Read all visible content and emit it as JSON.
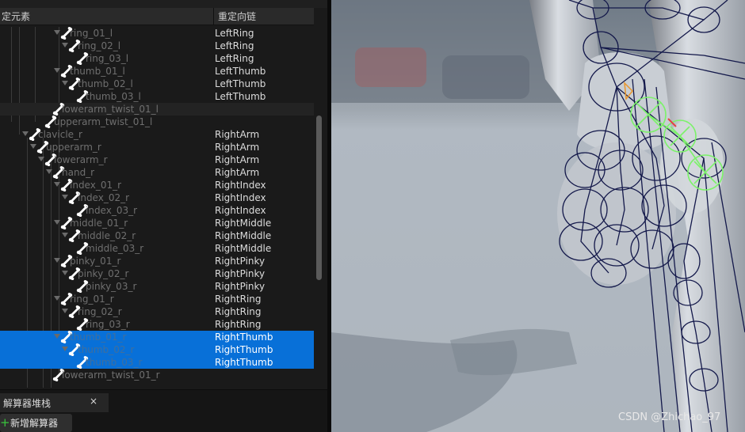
{
  "columns": {
    "element": "定元素",
    "chain": "重定向链"
  },
  "rows": [
    {
      "name": "ring_01_l",
      "chain": "LeftRing",
      "depth": 5,
      "expander": true,
      "state": ""
    },
    {
      "name": "ring_02_l",
      "chain": "LeftRing",
      "depth": 6,
      "expander": true,
      "state": ""
    },
    {
      "name": "ring_03_l",
      "chain": "LeftRing",
      "depth": 7,
      "expander": false,
      "state": ""
    },
    {
      "name": "thumb_01_l",
      "chain": "LeftThumb",
      "depth": 5,
      "expander": true,
      "state": ""
    },
    {
      "name": "thumb_02_l",
      "chain": "LeftThumb",
      "depth": 6,
      "expander": true,
      "state": ""
    },
    {
      "name": "thumb_03_l",
      "chain": "LeftThumb",
      "depth": 7,
      "expander": false,
      "state": ""
    },
    {
      "name": "lowerarm_twist_01_l",
      "chain": "",
      "depth": 4,
      "expander": false,
      "state": "hover"
    },
    {
      "name": "upperarm_twist_01_l",
      "chain": "",
      "depth": 3,
      "expander": false,
      "state": ""
    },
    {
      "name": "clavicle_r",
      "chain": "RightArm",
      "depth": 1,
      "expander": true,
      "state": ""
    },
    {
      "name": "upperarm_r",
      "chain": "RightArm",
      "depth": 2,
      "expander": true,
      "state": ""
    },
    {
      "name": "lowerarm_r",
      "chain": "RightArm",
      "depth": 3,
      "expander": true,
      "state": ""
    },
    {
      "name": "hand_r",
      "chain": "RightArm",
      "depth": 4,
      "expander": true,
      "state": ""
    },
    {
      "name": "index_01_r",
      "chain": "RightIndex",
      "depth": 5,
      "expander": true,
      "state": ""
    },
    {
      "name": "index_02_r",
      "chain": "RightIndex",
      "depth": 6,
      "expander": true,
      "state": ""
    },
    {
      "name": "index_03_r",
      "chain": "RightIndex",
      "depth": 7,
      "expander": false,
      "state": ""
    },
    {
      "name": "middle_01_r",
      "chain": "RightMiddle",
      "depth": 5,
      "expander": true,
      "state": ""
    },
    {
      "name": "middle_02_r",
      "chain": "RightMiddle",
      "depth": 6,
      "expander": true,
      "state": ""
    },
    {
      "name": "middle_03_r",
      "chain": "RightMiddle",
      "depth": 7,
      "expander": false,
      "state": ""
    },
    {
      "name": "pinky_01_r",
      "chain": "RightPinky",
      "depth": 5,
      "expander": true,
      "state": ""
    },
    {
      "name": "pinky_02_r",
      "chain": "RightPinky",
      "depth": 6,
      "expander": true,
      "state": ""
    },
    {
      "name": "pinky_03_r",
      "chain": "RightPinky",
      "depth": 7,
      "expander": false,
      "state": ""
    },
    {
      "name": "ring_01_r",
      "chain": "RightRing",
      "depth": 5,
      "expander": true,
      "state": ""
    },
    {
      "name": "ring_02_r",
      "chain": "RightRing",
      "depth": 6,
      "expander": true,
      "state": ""
    },
    {
      "name": "ring_03_r",
      "chain": "RightRing",
      "depth": 7,
      "expander": false,
      "state": ""
    },
    {
      "name": "thumb_01_r",
      "chain": "RightThumb",
      "depth": 5,
      "expander": true,
      "state": "selected"
    },
    {
      "name": "thumb_02_r",
      "chain": "RightThumb",
      "depth": 6,
      "expander": true,
      "state": "selected"
    },
    {
      "name": "thumb_03_r",
      "chain": "RightThumb",
      "depth": 7,
      "expander": false,
      "state": "selected"
    },
    {
      "name": "lowerarm_twist_01_r",
      "chain": "",
      "depth": 4,
      "expander": false,
      "state": ""
    }
  ],
  "bottom_panel": {
    "tab_label": "解算器堆栈",
    "tab_close": "×",
    "add_button_icon": "+",
    "add_button_label": "新增解算器"
  },
  "icons": {
    "bone": "bone-icon",
    "expander": "chevron-down-icon",
    "add": "plus-icon"
  },
  "colors": {
    "selection": "#0870d8",
    "bone_icon": "#ffffff",
    "add_icon": "#39c43d",
    "skeleton_wire": "#13184a",
    "ik_gizmo": "#7cf26a"
  },
  "watermark": "CSDN @Zhichao_97"
}
